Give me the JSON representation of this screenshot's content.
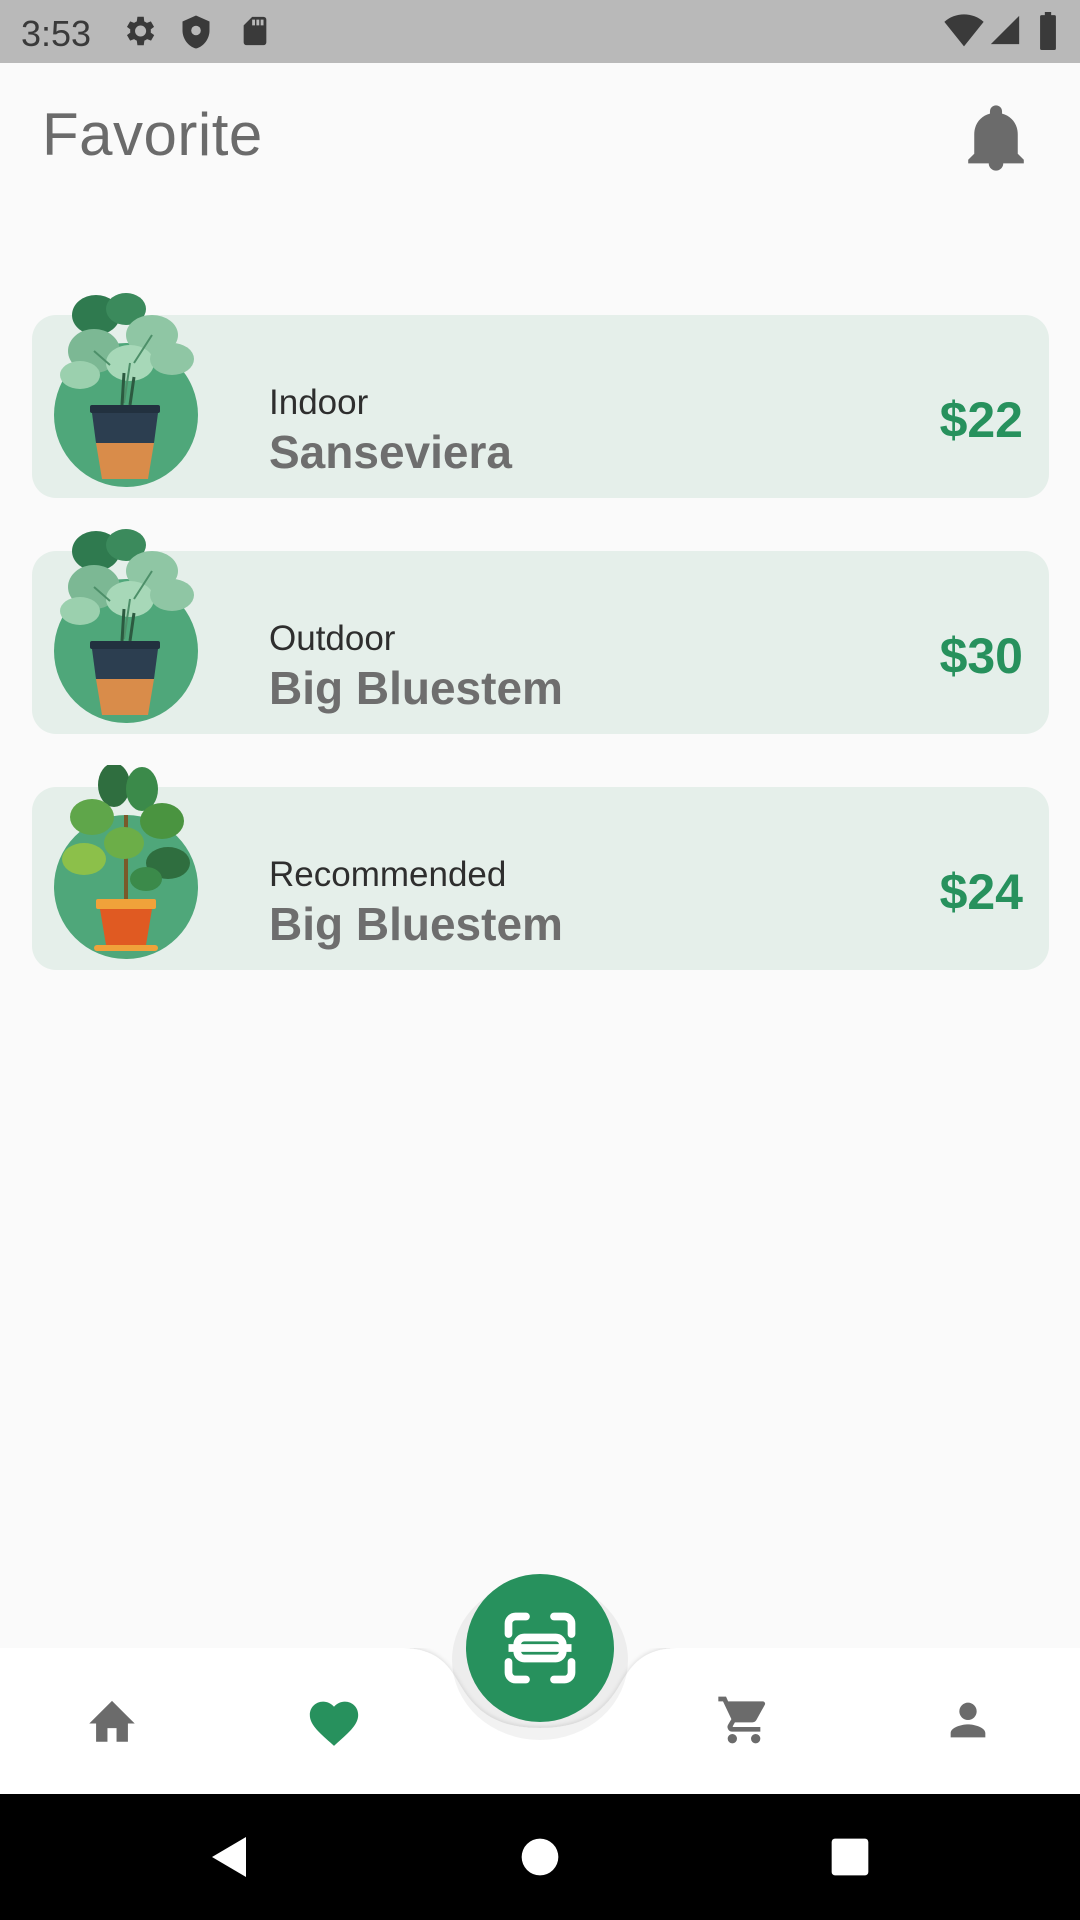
{
  "status_bar": {
    "time": "3:53",
    "left_icons": [
      "gear-icon",
      "shield-icon",
      "sd-card-icon"
    ],
    "right_icons": [
      "wifi-icon",
      "signal-icon",
      "battery-icon"
    ]
  },
  "header": {
    "title": "Favorite",
    "notification_icon": "bell-icon"
  },
  "favorites": [
    {
      "category": "Indoor",
      "name": "Sanseviera",
      "price": "$22",
      "image": "potted-plant-monstera"
    },
    {
      "category": "Outdoor",
      "name": "Big Bluestem",
      "price": "$30",
      "image": "potted-plant-monstera"
    },
    {
      "category": "Recommended",
      "name": "Big Bluestem",
      "price": "$24",
      "image": "potted-plant-fiddle-leaf"
    }
  ],
  "bottom_nav": {
    "items": [
      "home-icon",
      "heart-icon",
      "scan-icon",
      "cart-icon",
      "person-icon"
    ],
    "active": "heart-icon"
  },
  "colors": {
    "accent": "#27915d",
    "card_bg": "#e5efea",
    "title_text": "#6b6b6b",
    "inactive_icon": "#6b6b6b"
  }
}
